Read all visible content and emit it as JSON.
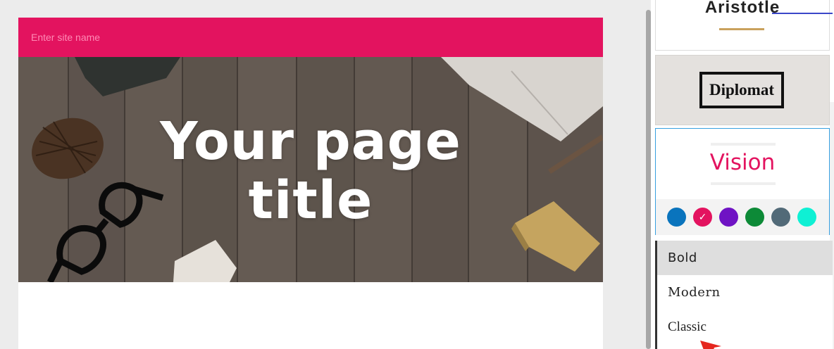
{
  "site": {
    "name_placeholder": "Enter site name",
    "hero_title_line1": "Your page",
    "hero_title_line2": "title",
    "header_color": "#e3135f"
  },
  "themes": {
    "cards": [
      {
        "name": "Aristotle"
      },
      {
        "name": "Diplomat"
      },
      {
        "name": "Vision",
        "selected": true
      }
    ],
    "colors": [
      {
        "name": "blue",
        "hex": "#0a74bd"
      },
      {
        "name": "pink",
        "hex": "#e3135f",
        "selected": true
      },
      {
        "name": "purple",
        "hex": "#6f13c4"
      },
      {
        "name": "green",
        "hex": "#0d8a37"
      },
      {
        "name": "slate",
        "hex": "#526a78"
      },
      {
        "name": "aqua",
        "hex": "#0ff0d4"
      }
    ]
  },
  "font_menu": {
    "options": [
      {
        "label": "Bold",
        "selected": true
      },
      {
        "label": "Modern"
      },
      {
        "label": "Classic"
      }
    ]
  },
  "icons": {
    "selected_swatch": "check-icon",
    "cursor": "arrow-cursor-icon"
  }
}
